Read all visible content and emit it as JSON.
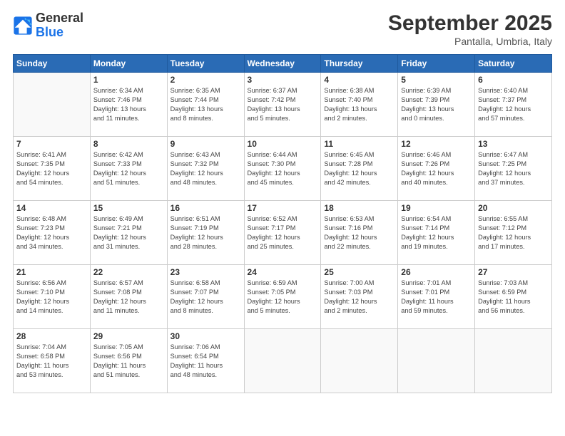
{
  "logo": {
    "line1": "General",
    "line2": "Blue"
  },
  "title": "September 2025",
  "location": "Pantalla, Umbria, Italy",
  "weekdays": [
    "Sunday",
    "Monday",
    "Tuesday",
    "Wednesday",
    "Thursday",
    "Friday",
    "Saturday"
  ],
  "weeks": [
    [
      {
        "day": "",
        "info": ""
      },
      {
        "day": "1",
        "info": "Sunrise: 6:34 AM\nSunset: 7:46 PM\nDaylight: 13 hours\nand 11 minutes."
      },
      {
        "day": "2",
        "info": "Sunrise: 6:35 AM\nSunset: 7:44 PM\nDaylight: 13 hours\nand 8 minutes."
      },
      {
        "day": "3",
        "info": "Sunrise: 6:37 AM\nSunset: 7:42 PM\nDaylight: 13 hours\nand 5 minutes."
      },
      {
        "day": "4",
        "info": "Sunrise: 6:38 AM\nSunset: 7:40 PM\nDaylight: 13 hours\nand 2 minutes."
      },
      {
        "day": "5",
        "info": "Sunrise: 6:39 AM\nSunset: 7:39 PM\nDaylight: 13 hours\nand 0 minutes."
      },
      {
        "day": "6",
        "info": "Sunrise: 6:40 AM\nSunset: 7:37 PM\nDaylight: 12 hours\nand 57 minutes."
      }
    ],
    [
      {
        "day": "7",
        "info": "Sunrise: 6:41 AM\nSunset: 7:35 PM\nDaylight: 12 hours\nand 54 minutes."
      },
      {
        "day": "8",
        "info": "Sunrise: 6:42 AM\nSunset: 7:33 PM\nDaylight: 12 hours\nand 51 minutes."
      },
      {
        "day": "9",
        "info": "Sunrise: 6:43 AM\nSunset: 7:32 PM\nDaylight: 12 hours\nand 48 minutes."
      },
      {
        "day": "10",
        "info": "Sunrise: 6:44 AM\nSunset: 7:30 PM\nDaylight: 12 hours\nand 45 minutes."
      },
      {
        "day": "11",
        "info": "Sunrise: 6:45 AM\nSunset: 7:28 PM\nDaylight: 12 hours\nand 42 minutes."
      },
      {
        "day": "12",
        "info": "Sunrise: 6:46 AM\nSunset: 7:26 PM\nDaylight: 12 hours\nand 40 minutes."
      },
      {
        "day": "13",
        "info": "Sunrise: 6:47 AM\nSunset: 7:25 PM\nDaylight: 12 hours\nand 37 minutes."
      }
    ],
    [
      {
        "day": "14",
        "info": "Sunrise: 6:48 AM\nSunset: 7:23 PM\nDaylight: 12 hours\nand 34 minutes."
      },
      {
        "day": "15",
        "info": "Sunrise: 6:49 AM\nSunset: 7:21 PM\nDaylight: 12 hours\nand 31 minutes."
      },
      {
        "day": "16",
        "info": "Sunrise: 6:51 AM\nSunset: 7:19 PM\nDaylight: 12 hours\nand 28 minutes."
      },
      {
        "day": "17",
        "info": "Sunrise: 6:52 AM\nSunset: 7:17 PM\nDaylight: 12 hours\nand 25 minutes."
      },
      {
        "day": "18",
        "info": "Sunrise: 6:53 AM\nSunset: 7:16 PM\nDaylight: 12 hours\nand 22 minutes."
      },
      {
        "day": "19",
        "info": "Sunrise: 6:54 AM\nSunset: 7:14 PM\nDaylight: 12 hours\nand 19 minutes."
      },
      {
        "day": "20",
        "info": "Sunrise: 6:55 AM\nSunset: 7:12 PM\nDaylight: 12 hours\nand 17 minutes."
      }
    ],
    [
      {
        "day": "21",
        "info": "Sunrise: 6:56 AM\nSunset: 7:10 PM\nDaylight: 12 hours\nand 14 minutes."
      },
      {
        "day": "22",
        "info": "Sunrise: 6:57 AM\nSunset: 7:08 PM\nDaylight: 12 hours\nand 11 minutes."
      },
      {
        "day": "23",
        "info": "Sunrise: 6:58 AM\nSunset: 7:07 PM\nDaylight: 12 hours\nand 8 minutes."
      },
      {
        "day": "24",
        "info": "Sunrise: 6:59 AM\nSunset: 7:05 PM\nDaylight: 12 hours\nand 5 minutes."
      },
      {
        "day": "25",
        "info": "Sunrise: 7:00 AM\nSunset: 7:03 PM\nDaylight: 12 hours\nand 2 minutes."
      },
      {
        "day": "26",
        "info": "Sunrise: 7:01 AM\nSunset: 7:01 PM\nDaylight: 11 hours\nand 59 minutes."
      },
      {
        "day": "27",
        "info": "Sunrise: 7:03 AM\nSunset: 6:59 PM\nDaylight: 11 hours\nand 56 minutes."
      }
    ],
    [
      {
        "day": "28",
        "info": "Sunrise: 7:04 AM\nSunset: 6:58 PM\nDaylight: 11 hours\nand 53 minutes."
      },
      {
        "day": "29",
        "info": "Sunrise: 7:05 AM\nSunset: 6:56 PM\nDaylight: 11 hours\nand 51 minutes."
      },
      {
        "day": "30",
        "info": "Sunrise: 7:06 AM\nSunset: 6:54 PM\nDaylight: 11 hours\nand 48 minutes."
      },
      {
        "day": "",
        "info": ""
      },
      {
        "day": "",
        "info": ""
      },
      {
        "day": "",
        "info": ""
      },
      {
        "day": "",
        "info": ""
      }
    ]
  ]
}
